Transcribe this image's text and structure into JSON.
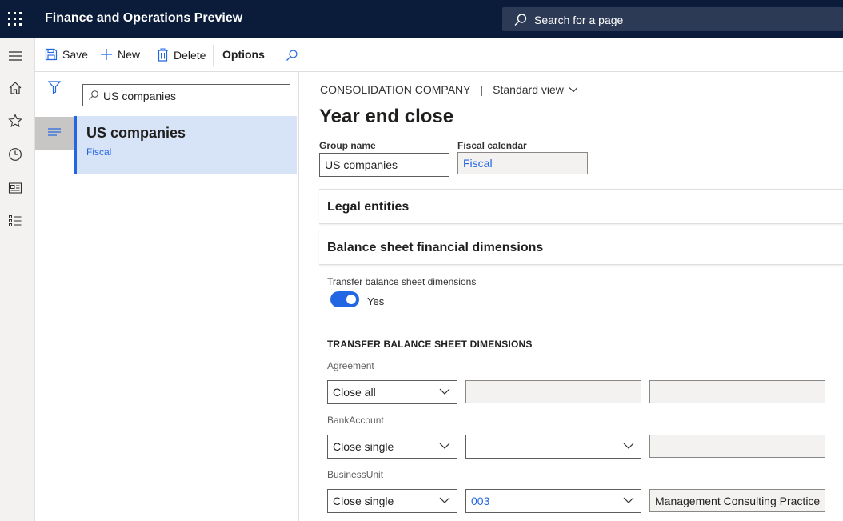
{
  "app": {
    "title": "Finance and Operations Preview"
  },
  "search": {
    "label": "Search for a page"
  },
  "toolbar": {
    "save": "Save",
    "new": "New",
    "delete": "Delete",
    "options": "Options"
  },
  "list": {
    "search_value": "US companies",
    "items": [
      {
        "title": "US companies",
        "subtitle": "Fiscal"
      }
    ]
  },
  "details": {
    "breadcrumb": "CONSOLIDATION COMPANY",
    "view": "Standard view",
    "title": "Year end close",
    "group_name_label": "Group name",
    "group_name_value": "US companies",
    "fiscal_calendar_label": "Fiscal calendar",
    "fiscal_calendar_value": "Fiscal",
    "fasttabs": [
      "Legal entities",
      "Balance sheet financial dimensions"
    ],
    "transfer_label": "Transfer balance sheet dimensions",
    "transfer_value": "Yes",
    "section_header": "TRANSFER BALANCE SHEET DIMENSIONS",
    "dimensions": [
      {
        "name": "Agreement",
        "option": "Close all",
        "value": "",
        "description": ""
      },
      {
        "name": "BankAccount",
        "option": "Close single",
        "value": "",
        "description": ""
      },
      {
        "name": "BusinessUnit",
        "option": "Close single",
        "value": "003",
        "description": "Management Consulting Practice"
      }
    ]
  },
  "colors": {
    "topbar": "#0b1c3a",
    "accent": "#2266e3",
    "selected_row": "#d7e3f7"
  }
}
